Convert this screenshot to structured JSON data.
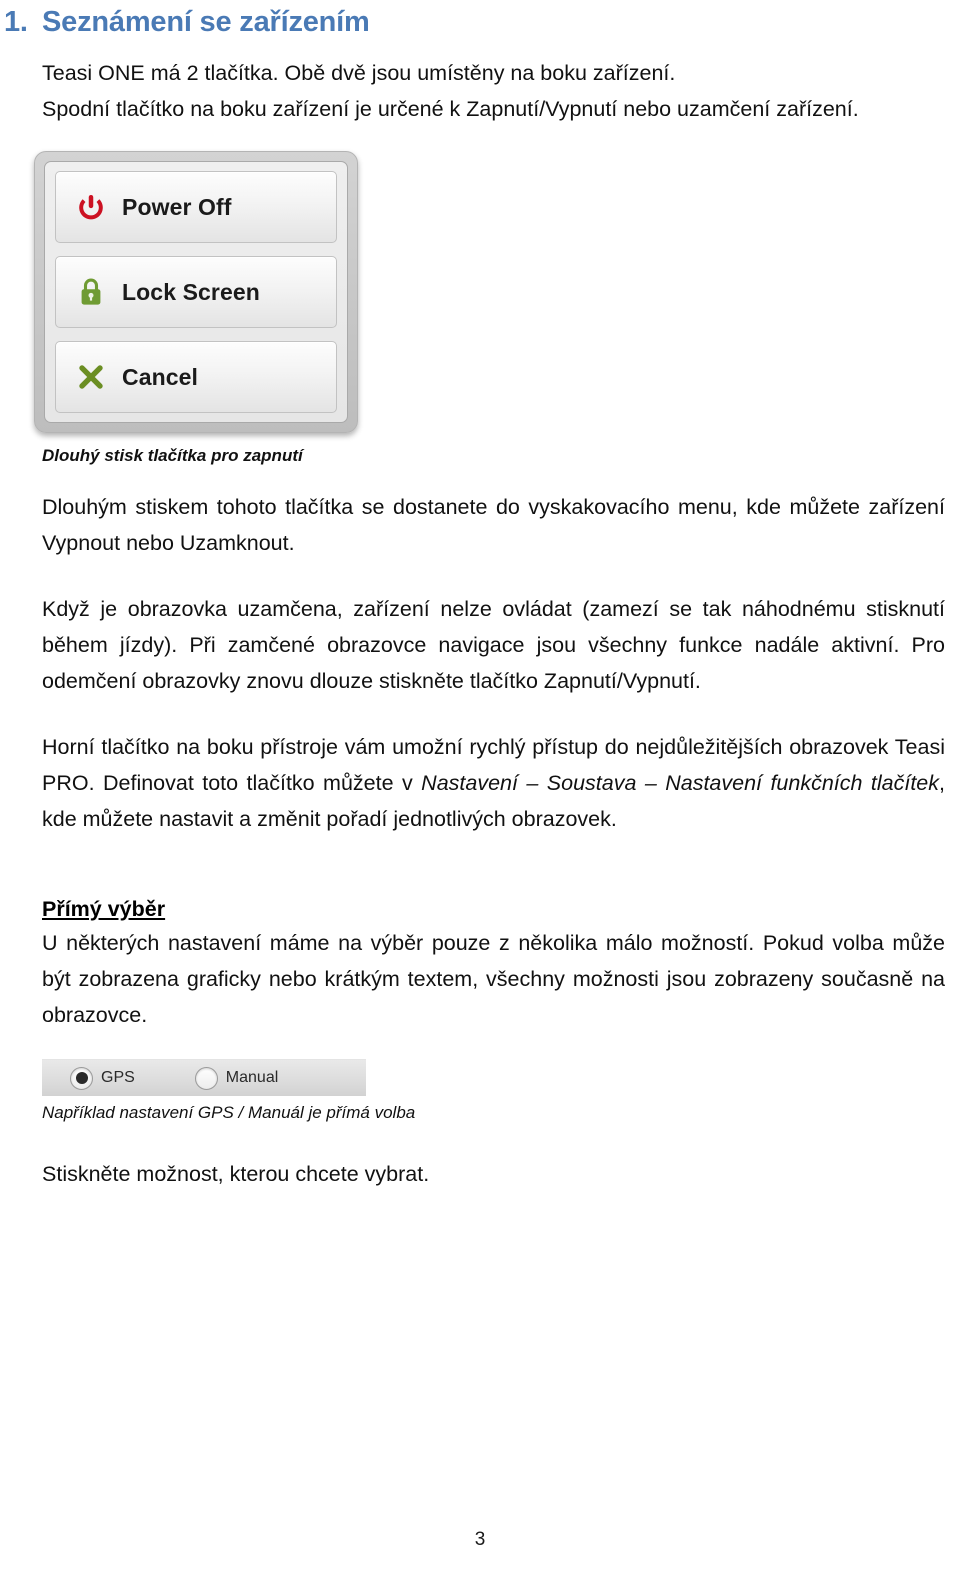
{
  "document": {
    "language": "cs",
    "page_number": "3",
    "heading": {
      "number": "1.",
      "title": "Seznámení se zařízením",
      "color": "#4a7ab5"
    },
    "intro": {
      "line1": "Teasi ONE má 2 tlačítka. Obě dvě jsou umístěny na boku zařízení.",
      "line2": "Spodní tlačítko na boku zařízení je určené k Zapnutí/Vypnutí nebo uzamčení zařízení."
    },
    "power_menu": {
      "items": [
        {
          "icon": "power-icon",
          "label": "Power Off",
          "color": "#cc1122"
        },
        {
          "icon": "lock-icon",
          "label": "Lock Screen",
          "color": "#6f9b33"
        },
        {
          "icon": "close-x-icon",
          "label": "Cancel",
          "color": "#6b8e23"
        }
      ],
      "caption": "Dlouhý stisk tlačítka pro zapnutí"
    },
    "paragraphs": {
      "p1": "Dlouhým stiskem tohoto tlačítka se dostanete do vyskakovacího menu, kde můžete zařízení Vypnout nebo Uzamknout.",
      "p2": "Když je obrazovka uzamčena, zařízení nelze ovládat (zamezí se tak náhodnému stisknutí během jízdy). Při zamčené obrazovce navigace jsou všechny funkce nadále aktivní. Pro odemčení obrazovky znovu dlouze stiskněte tlačítko Zapnutí/Vypnutí.",
      "p3_part1": "Horní tlačítko na boku přístroje vám umožní rychlý přístup do nejdůležitějších obrazovek Teasi PRO. Definovat toto tlačítko můžete v ",
      "p3_italic1": "Nastavení – Soustava – Nastavení funkčních tlačítek",
      "p3_part2": ", kde můžete nastavit a změnit pořadí jednotlivých obrazovek."
    },
    "direct_selection": {
      "title": "Přímý výběr",
      "body": "U některých nastavení máme na výběr pouze z několika málo možností. Pokud volba může být zobrazena graficky nebo krátkým textem, všechny možnosti jsou zobrazeny současně na obrazovce.",
      "radio_options": [
        {
          "label": "GPS",
          "selected": true
        },
        {
          "label": "Manual",
          "selected": false
        }
      ],
      "caption": "Například nastavení GPS / Manuál je přímá volba",
      "closing": "Stiskněte možnost, kterou chcete vybrat."
    }
  }
}
